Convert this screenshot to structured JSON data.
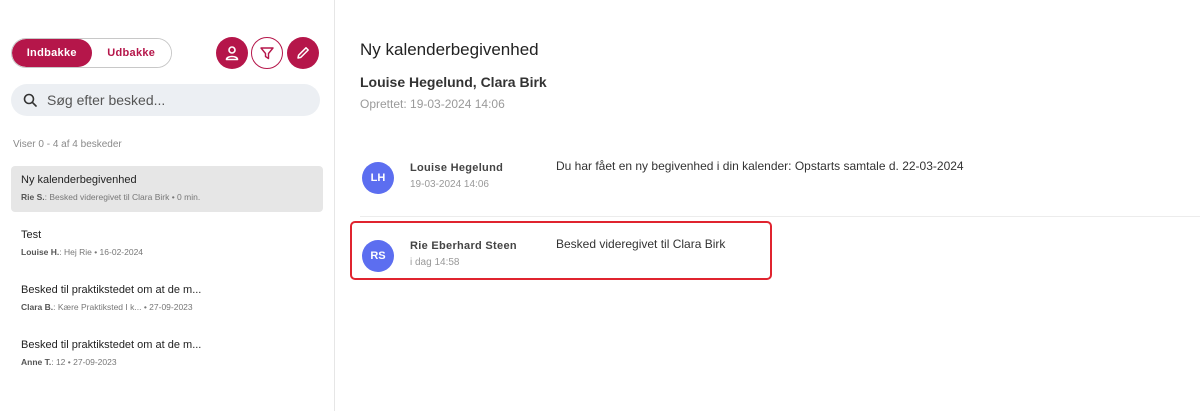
{
  "tabs": {
    "inbox": "Indbakke",
    "outbox": "Udbakke",
    "active": "inbox"
  },
  "toolbar": {
    "icons": [
      "user-icon",
      "filter-icon",
      "pencil-icon"
    ],
    "accent_color": "#b5164a"
  },
  "search": {
    "placeholder": "Søg efter besked..."
  },
  "list": {
    "count_text": "Viser 0 - 4 af 4 beskeder",
    "items": [
      {
        "title": "Ny kalenderbegivenhed",
        "sender": "Rie S.",
        "preview": ": Besked videregivet til Clara Birk • 0 min.",
        "selected": true
      },
      {
        "title": "Test",
        "sender": "Louise H.",
        "preview": ": Hej Rie • 16-02-2024",
        "selected": false
      },
      {
        "title": "Besked til praktikstedet om at de m...",
        "sender": "Clara B.",
        "preview": ": Kære Praktiksted I k... • 27-09-2023",
        "selected": false
      },
      {
        "title": "Besked til praktikstedet om at de m...",
        "sender": "Anne T.",
        "preview": ": 12 • 27-09-2023",
        "selected": false
      }
    ]
  },
  "thread": {
    "subject": "Ny kalenderbegivenhed",
    "participants": "Louise Hegelund, Clara Birk",
    "created": "Oprettet: 19-03-2024 14:06",
    "avatar_color": "#5c6ef0",
    "highlight_color": "#e0242f",
    "messages": [
      {
        "initials": "LH",
        "author": "Louise Hegelund",
        "time": "19-03-2024 14:06",
        "text": "Du har fået en ny begivenhed i din kalender: Opstarts samtale d. 22-03-2024"
      },
      {
        "initials": "RS",
        "author": "Rie Eberhard Steen",
        "time": "i dag 14:58",
        "text": "Besked videregivet til Clara Birk",
        "highlighted": true
      }
    ]
  }
}
